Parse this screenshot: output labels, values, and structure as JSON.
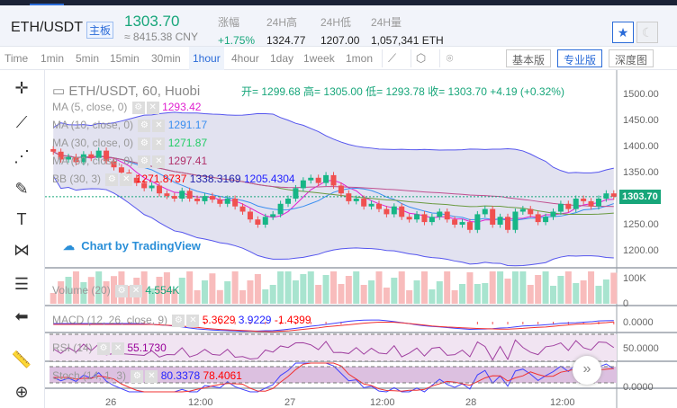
{
  "header": {
    "pair": "ETH/USDT",
    "tag": "主板",
    "price": "1303.70",
    "cny": "≈ 8415.38 CNY",
    "stats": [
      {
        "label": "涨幅",
        "value": "+1.75%",
        "color": "#17a67a"
      },
      {
        "label": "24H高",
        "value": "1324.77"
      },
      {
        "label": "24H低",
        "value": "1207.00"
      },
      {
        "label": "24H量",
        "value": "1,057,341 ETH"
      }
    ]
  },
  "toolbar": {
    "timeframes": [
      "Time",
      "1min",
      "5min",
      "15min",
      "30min",
      "1hour",
      "4hour",
      "1day",
      "1week",
      "1mon"
    ],
    "active": "1hour",
    "views": [
      "基本版",
      "专业版",
      "深度图"
    ],
    "active_view": "专业版"
  },
  "chart": {
    "title": "ETH/USDT, 60, Huobi",
    "ohlc": "开= 1299.68 高= 1305.00 低= 1293.78 收= 1303.70 +4.19 (+0.32%)",
    "indicators": [
      {
        "label": "MA (5, close, 0)",
        "value": "1293.42",
        "color": "#e020d0"
      },
      {
        "label": "MA (10, close, 0)",
        "value": "1291.17",
        "color": "#3a8ef0"
      },
      {
        "label": "MA (30, close, 0)",
        "value": "1271.87",
        "color": "#22cc66"
      },
      {
        "label": "MA (60, close, 0)",
        "value": "1297.41",
        "color": "#b0306a"
      },
      {
        "label": "BB (30, 3)",
        "value": "1271.8737",
        "value2": "1338.3169",
        "value3": "1205.4304",
        "color": "#f00"
      }
    ],
    "price_ticks": [
      "1500.00",
      "1450.00",
      "1400.00",
      "1350.00",
      "1300.00",
      "1250.00",
      "1200.00"
    ],
    "last_price": "1303.70",
    "watermark": "Chart by TradingView",
    "volume": {
      "label": "Volume (20)",
      "value": "4.554K",
      "ticks": [
        "100K",
        "0"
      ]
    },
    "macd": {
      "label": "MACD (12, 26, close, 9)",
      "v1": "5.3629",
      "v2": "3.9229",
      "v3": "-1.4399",
      "tick": "0.0000"
    },
    "rsi": {
      "label": "RSI (14)",
      "value": "55.1730",
      "tick": "50.0000"
    },
    "stoch": {
      "label": "Stoch (14, 1, 3)",
      "v1": "80.3378",
      "v2": "78.4061",
      "tick": "0.0000"
    },
    "time_ticks": [
      "26",
      "12:00",
      "27",
      "12:00",
      "28",
      "12:00"
    ],
    "closes": [
      1390,
      1375,
      1380,
      1370,
      1385,
      1378,
      1392,
      1372,
      1360,
      1350,
      1340,
      1330,
      1320,
      1325,
      1310,
      1305,
      1300,
      1315,
      1300,
      1295,
      1305,
      1298,
      1290,
      1300,
      1285,
      1275,
      1260,
      1250,
      1265,
      1270,
      1290,
      1300,
      1320,
      1335,
      1340,
      1330,
      1345,
      1325,
      1310,
      1295,
      1300,
      1285,
      1290,
      1280,
      1270,
      1285,
      1265,
      1260,
      1270,
      1255,
      1265,
      1275,
      1260,
      1250,
      1255,
      1240,
      1270,
      1280,
      1250,
      1265,
      1240,
      1275,
      1280,
      1270,
      1255,
      1265,
      1275,
      1290,
      1280,
      1300,
      1295,
      1285,
      1300,
      1310,
      1303.7
    ]
  }
}
